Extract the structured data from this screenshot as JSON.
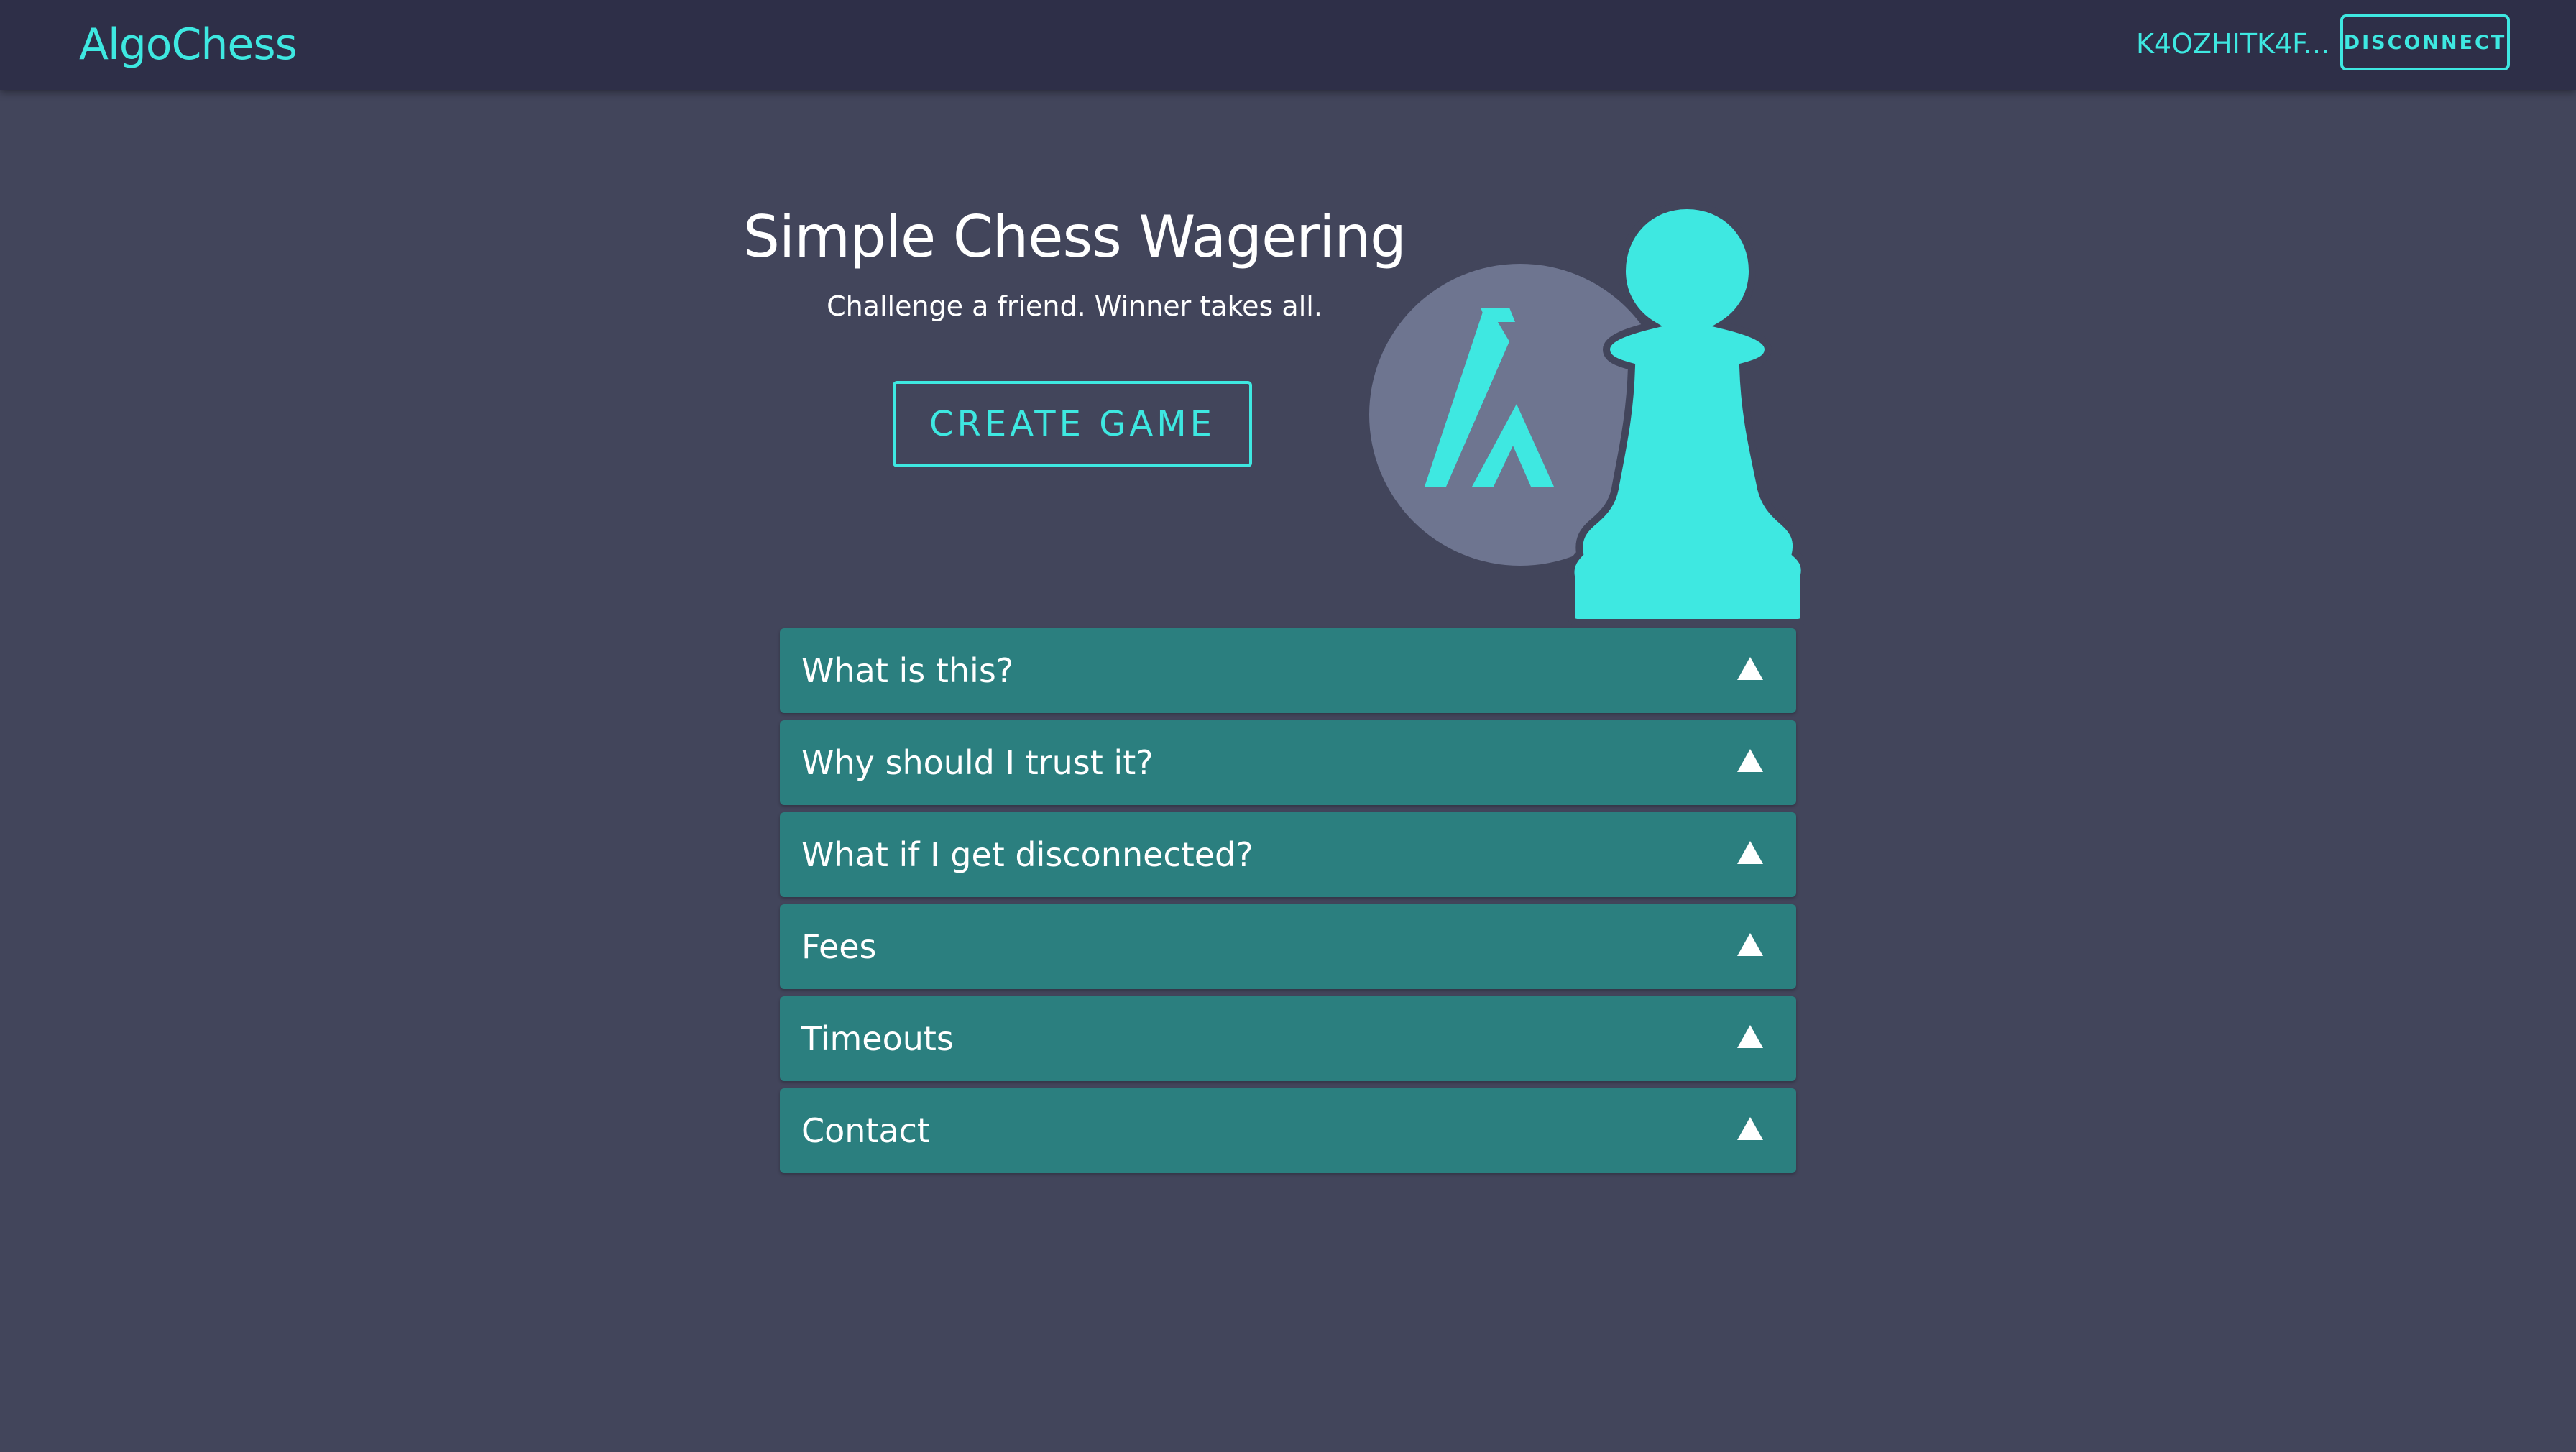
{
  "colors": {
    "background": "#42455b",
    "navbar": "#2e2f48",
    "accent": "#3ee8e1",
    "faq_item": "#2b7f7f",
    "algo_circle": "#6e7590"
  },
  "navbar": {
    "brand": "AlgoChess",
    "address": "K4OZHITK4F...",
    "disconnect_label": "DISCONNECT"
  },
  "hero": {
    "title": "Simple Chess Wagering",
    "subtitle": "Challenge a friend. Winner takes all.",
    "create_game_label": "CREATE GAME",
    "art_icons": [
      "algorand-logo-icon",
      "pawn-icon"
    ]
  },
  "faq": {
    "toggle_icon": "triangle-up-icon",
    "items": [
      {
        "question": "What is this?"
      },
      {
        "question": "Why should I trust it?"
      },
      {
        "question": "What if I get disconnected?"
      },
      {
        "question": "Fees"
      },
      {
        "question": "Timeouts"
      },
      {
        "question": "Contact"
      }
    ]
  }
}
